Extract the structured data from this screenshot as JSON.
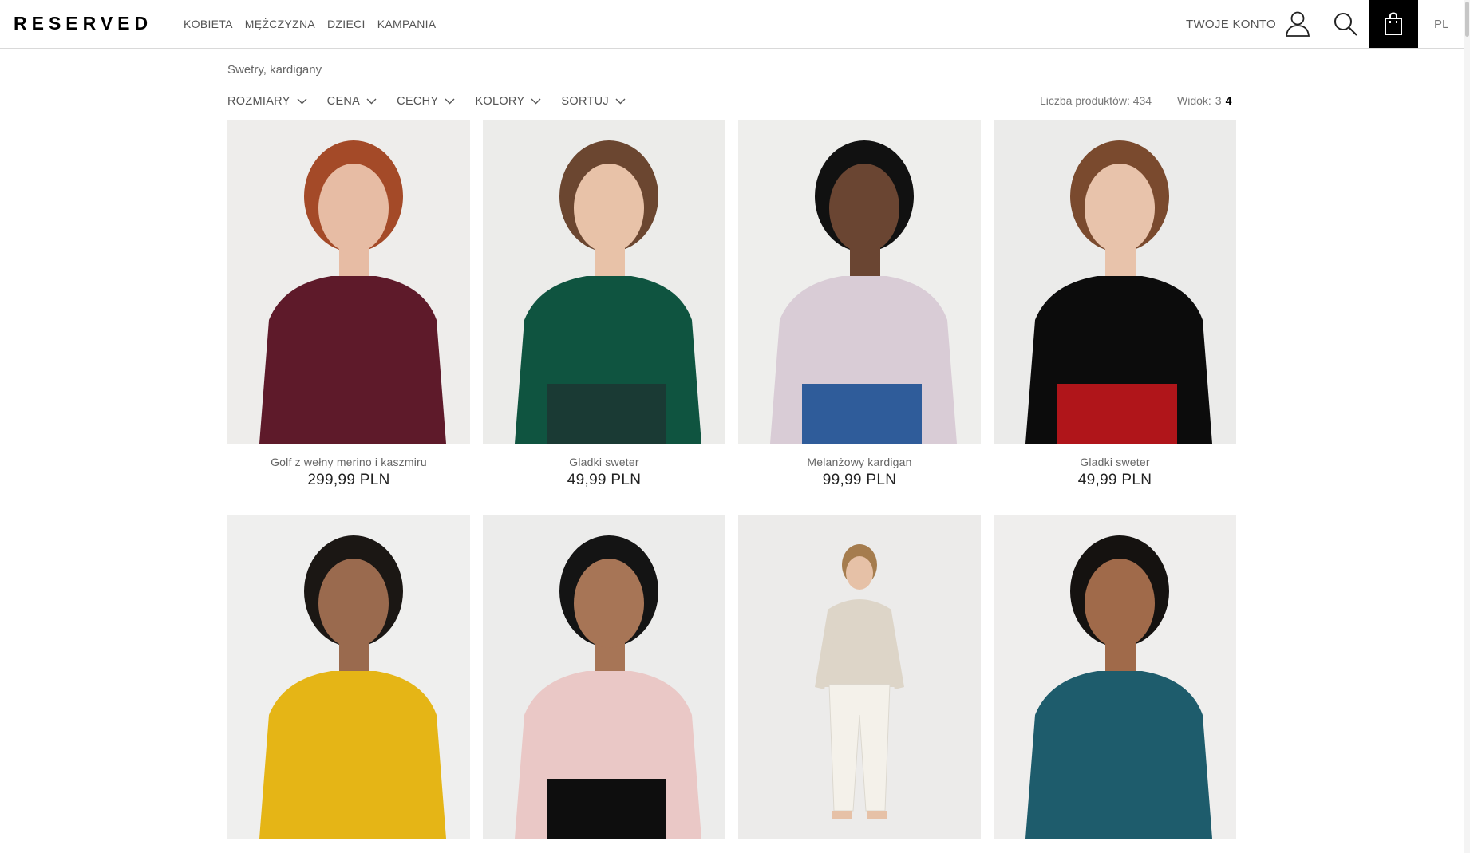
{
  "header": {
    "logo": "RESERVED",
    "nav": [
      "KOBIETA",
      "MĘŻCZYZNA",
      "DZIECI",
      "KAMPANIA"
    ],
    "account": "TWOJE KONTO",
    "lang": "PL"
  },
  "breadcrumb": "Swetry, kardigany",
  "filters": [
    "ROZMIARY",
    "CENA",
    "CECHY",
    "KOLORY",
    "SORTUJ"
  ],
  "product_count": "Liczba produktów: 434",
  "view": {
    "label": "Widok:",
    "options": [
      "3",
      "4"
    ],
    "active": "4"
  },
  "products": [
    {
      "name": "Golf z wełny merino i kaszmiru",
      "price": "299,99 PLN",
      "garment": "#5e1a2a",
      "skin": "#e7bca4",
      "hair": "#a44a28",
      "bottom": "#5e1a2a",
      "bg": "#eeedeb"
    },
    {
      "name": "Gladki sweter",
      "price": "49,99 PLN",
      "garment": "#0f5440",
      "skin": "#e8c2a8",
      "hair": "#6b4630",
      "bottom": "#1a3a34",
      "bg": "#ececea"
    },
    {
      "name": "Melanżowy kardigan",
      "price": "99,99 PLN",
      "garment": "#d9ccd6",
      "skin": "#6a4532",
      "hair": "#111111",
      "bottom": "#2f5c9a",
      "bg": "#eeeeec"
    },
    {
      "name": "Gladki sweter",
      "price": "49,99 PLN",
      "garment": "#0c0c0c",
      "skin": "#e8c3ab",
      "hair": "#7a4a2e",
      "bottom": "#b0151a",
      "bg": "#ebebea"
    },
    {
      "name": "",
      "price": "",
      "garment": "#e5b516",
      "skin": "#9a6a4e",
      "hair": "#1b1714",
      "bottom": "#e5b516",
      "bg": "#efefee"
    },
    {
      "name": "",
      "price": "",
      "garment": "#eac8c6",
      "skin": "#a77556",
      "hair": "#141414",
      "bottom": "#0e0e0e",
      "bg": "#ececeb"
    },
    {
      "name": "",
      "price": "",
      "garment": "#ddd5c8",
      "skin": "#e6c1a7",
      "hair": "#a57c4e",
      "bottom": "#f4f1ea",
      "bg": "#ecebea"
    },
    {
      "name": "",
      "price": "",
      "garment": "#1e5c6c",
      "skin": "#a06a4a",
      "hair": "#151210",
      "bottom": "#1e5c6c",
      "bg": "#efeeed"
    }
  ],
  "colors": {
    "accent": "#000000",
    "text": "#333333"
  }
}
